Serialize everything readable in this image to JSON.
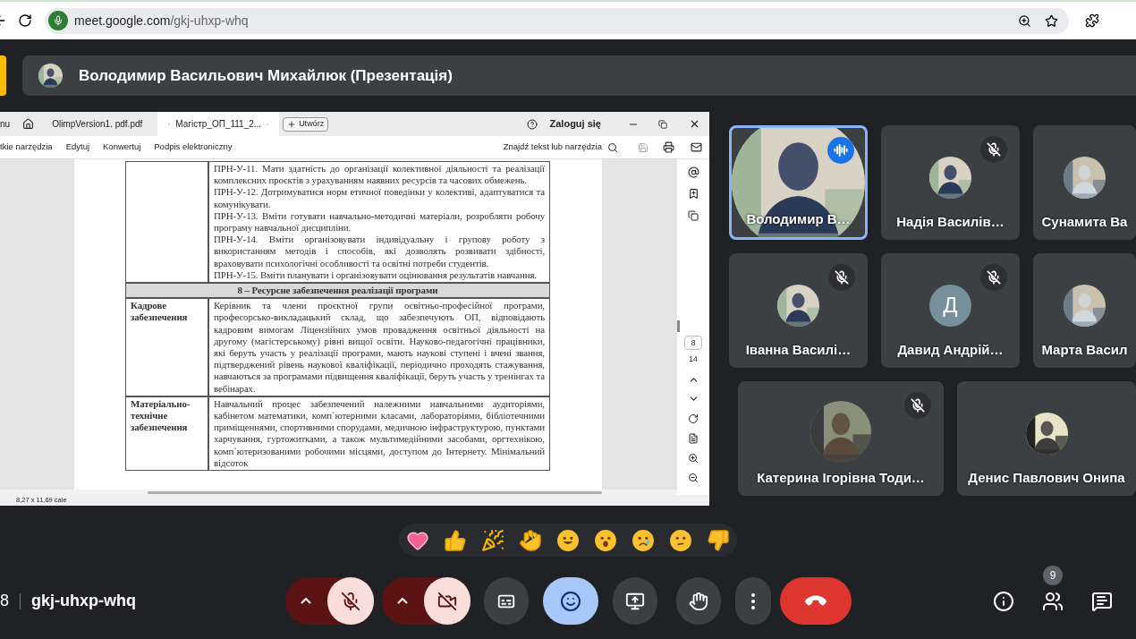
{
  "browser": {
    "url_host": "meet.google.com",
    "url_path": "/gkj-uhxp-whq"
  },
  "presenter_banner": {
    "title": "Володимир Васильович Михайлюк (Презентація)"
  },
  "shared_screen": {
    "cut_menu_label": "nu",
    "tabs": [
      {
        "label": "OlimpVersion1. pdf.pdf",
        "selected": false
      },
      {
        "label": "Магістр_ОП_111_2...",
        "selected": true
      }
    ],
    "new_tab_button": "Utwórz",
    "sign_in": "Zaloguj się",
    "menu": [
      "tkie narzędzia",
      "Edytuj",
      "Konwertuj",
      "Podpis elektroniczny"
    ],
    "search_label": "Znajdź tekst lub narzędzia",
    "page_current": "8",
    "page_total": "14",
    "page_size": "8,27 x 11,69 cale",
    "document": {
      "rows": [
        {
          "kind": "items",
          "paragraphs": [
            "ПРН-У-11. Мати здатність до організації колективної діяльності та реалізації комплексних проєктів з урахуванням наявних ресурсів та часових обмежень.",
            "ПРН-У-12. Дотримуватися норм етичної поведінки у колективі, адаптуватися та комунікувати.",
            "ПРН-У-13. Вміти готувати навчально-методичні матеріали, розробляти робочу програму навчальної дисципліни.",
            "ПРН-У-14. Вміти організовувати індивідуальну і групову роботу з використанням методів і способів, які дозволять розвивати здібності, враховувати психологічні особливості та освітні потреби студентів.",
            "ПРН-У-15. Вміти планувати і організовувати оцінювання результатів навчання."
          ]
        },
        {
          "kind": "section",
          "text": "8 – Ресурсне забезпечення реалізації програми"
        },
        {
          "kind": "entry",
          "label": "Кадрове забезпечення",
          "text": "Керівник та члени проєктної групи освітньо-професійної програми, професорсько-викладацький склад, що забезпечують ОП, відповідають кадровим вимогам Ліцензійних умов провадження освітньої діяльності на другому (магістерському) рівні вищої освіти. Науково-педагогічні працівники, які беруть участь у реалізації програми, мають наукові ступені і вчені звання, підтверджений рівень наукової кваліфікації, періодично проходять стажування, навчаються за програмами підвищення кваліфікації, беруть участь у тренінгах та вебінарах."
        },
        {
          "kind": "entry",
          "label": "Матеріально-технічне забезпечення",
          "text": "Навчальний процес забезпечений належними навчальними аудиторіями, кабінетом математики, комп`ютерними класами, лабораторіями, бібліотечними приміщеннями, спортивними спорудами, медичною інфраструктурою, пунктами харчування, гуртожитками, а також мультимедійними засобами, оргтехнікою, комп`ютеризованими робочими місцями, доступом до Інтернету. Мінімальний відсоток"
        }
      ]
    }
  },
  "participants": [
    {
      "name": "Володимир В…",
      "kind": "video",
      "speaking": true,
      "muted": false
    },
    {
      "name": "Надія Василів…",
      "speaking": false,
      "muted": true
    },
    {
      "name": "Сунамита Ва",
      "speaking": false
    },
    {
      "name": "Іванна Василі…",
      "speaking": false,
      "muted": true
    },
    {
      "name": "Давид Андрій…",
      "kind": "initial",
      "initial": "Д",
      "speaking": false,
      "muted": true
    },
    {
      "name": "Марта Васил",
      "speaking": false
    },
    {
      "name": "Катерина Ігорівна Тоди…",
      "speaking": false,
      "muted": true
    },
    {
      "name": "Денис Павлович Онипа",
      "speaking": false
    }
  ],
  "meeting": {
    "time": "8",
    "code": "gkj-uhxp-whq"
  },
  "controls": {
    "mic_on": false,
    "camera_on": false,
    "captions_on": false,
    "reactions_open": true
  },
  "people_count": "9"
}
